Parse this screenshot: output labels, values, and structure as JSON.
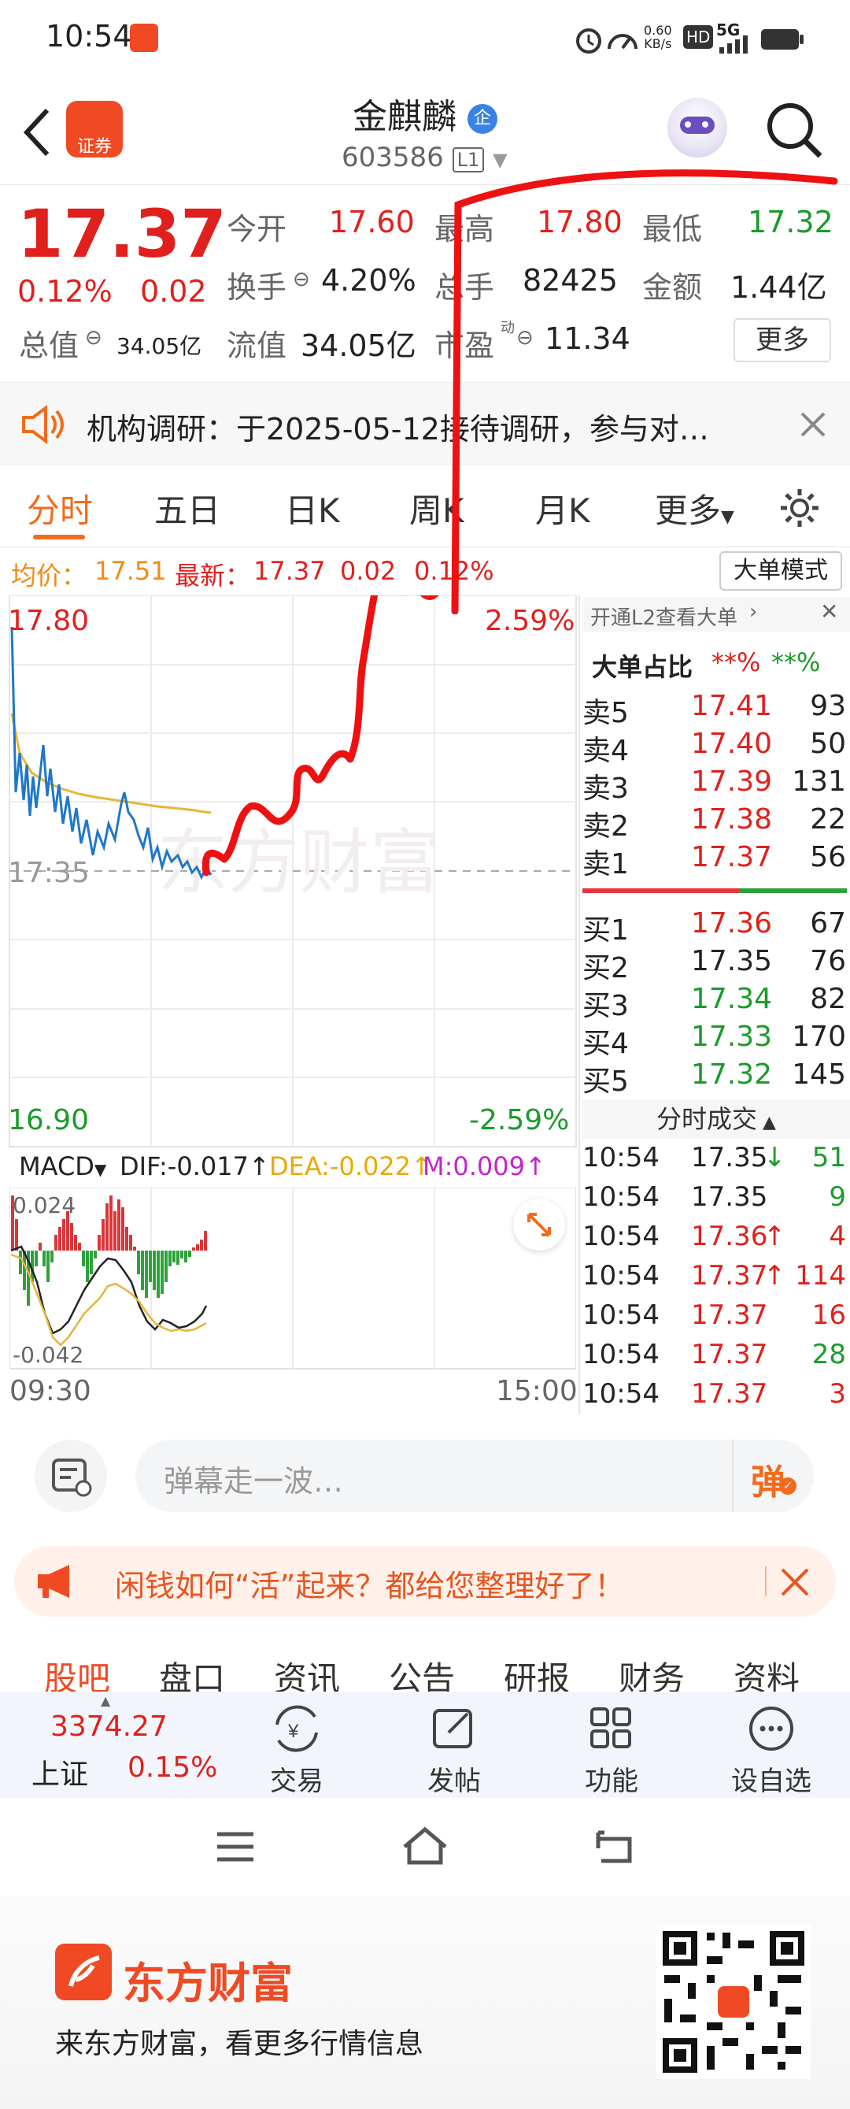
{
  "status_bar": {
    "time": "10:54",
    "net_speed": "0.60",
    "net_unit": "KB/s",
    "hd": "HD",
    "signal": "5G"
  },
  "header": {
    "logo_text": "证券",
    "stock_name": "金麒麟",
    "name_badge": "企",
    "stock_code": "603586",
    "level_badge": "L1"
  },
  "quote": {
    "price": "17.37",
    "change_pct": "0.12%",
    "change": "0.02",
    "row1": [
      {
        "label": "今开",
        "value": "17.60"
      },
      {
        "label": "最高",
        "value": "17.80"
      },
      {
        "label": "最低",
        "value": "17.32"
      }
    ],
    "row2": [
      {
        "label": "换手",
        "value": "4.20%"
      },
      {
        "label": "总手",
        "value": "82425"
      },
      {
        "label": "金额",
        "value": "1.44亿"
      }
    ],
    "row3": [
      {
        "label": "总值",
        "value": "34.05亿"
      },
      {
        "label": "流值",
        "value": "34.05亿"
      },
      {
        "label": "市盈",
        "sup": "动",
        "value": "11.34"
      }
    ],
    "more_label": "更多"
  },
  "notice": {
    "text": "机构调研：于2025-05-12接待调研，参与对…"
  },
  "chart_tabs": [
    "分时",
    "五日",
    "日K",
    "周K",
    "月K",
    "更多"
  ],
  "info_bar": {
    "avg_label": "均价：",
    "avg_value": "17.51",
    "latest_label": "最新：",
    "latest_value": "17.37",
    "change": "0.02",
    "change_pct": "0.12%",
    "mode_button": "大单模式"
  },
  "chart_labels": {
    "top_price": "17.80",
    "top_pct": "2.59%",
    "mid_price": "17:35",
    "bottom_price": "16.90",
    "bottom_pct": "-2.59%",
    "time_start": "09:30",
    "time_end": "15:00"
  },
  "macd": {
    "label": "MACD",
    "dif": "DIF:-0.017",
    "dea": "DEA:-0.022",
    "m": "M:0.009",
    "top_val": "0.024",
    "bottom_val": "-0.042"
  },
  "order_book": {
    "banner": "开通L2查看大单",
    "ratio_label": "大单占比",
    "ratio_red": "**%",
    "ratio_green": "**%",
    "sells": [
      {
        "label": "卖5",
        "price": "17.41",
        "vol": "93"
      },
      {
        "label": "卖4",
        "price": "17.40",
        "vol": "50"
      },
      {
        "label": "卖3",
        "price": "17.39",
        "vol": "131"
      },
      {
        "label": "卖2",
        "price": "17.38",
        "vol": "22"
      },
      {
        "label": "卖1",
        "price": "17.37",
        "vol": "56"
      }
    ],
    "buys": [
      {
        "label": "买1",
        "price": "17.36",
        "vol": "67"
      },
      {
        "label": "买2",
        "price": "17.35",
        "vol": "76"
      },
      {
        "label": "买3",
        "price": "17.34",
        "vol": "82"
      },
      {
        "label": "买4",
        "price": "17.33",
        "vol": "170"
      },
      {
        "label": "买5",
        "price": "17.32",
        "vol": "145"
      }
    ]
  },
  "trades": {
    "title": "分时成交",
    "rows": [
      {
        "time": "10:54",
        "price": "17.35",
        "arrow": "↓",
        "vol": "51"
      },
      {
        "time": "10:54",
        "price": "17.35",
        "arrow": "",
        "vol": "9"
      },
      {
        "time": "10:54",
        "price": "17.36",
        "arrow": "↑",
        "vol": "4"
      },
      {
        "time": "10:54",
        "price": "17.37",
        "arrow": "↑",
        "vol": "114"
      },
      {
        "time": "10:54",
        "price": "17.37",
        "arrow": "",
        "vol": "16"
      },
      {
        "time": "10:54",
        "price": "17.37",
        "arrow": "",
        "vol": "28"
      },
      {
        "time": "10:54",
        "price": "17.37",
        "arrow": "",
        "vol": "3"
      }
    ]
  },
  "danmu": {
    "placeholder": "弹幕走一波…",
    "button": "弹"
  },
  "ad": {
    "text": "闲钱如何“活”起来？都给您整理好了！"
  },
  "sub_tabs": [
    "股吧",
    "盘口",
    "资讯",
    "公告",
    "研报",
    "财务",
    "资料"
  ],
  "bottom_nav": {
    "index_value": "3374.27",
    "index_name": "上证",
    "index_pct": "0.15%",
    "items": [
      "交易",
      "发帖",
      "功能",
      "设自选"
    ]
  },
  "brand": {
    "name": "东方财富",
    "slogan": "来东方财富，看更多行情信息"
  },
  "colors": {
    "up": "#e0201c",
    "down": "#1a9b2a",
    "accent": "#f26b1d",
    "price_line": "#1f77c9",
    "avg_line": "#e7b53a"
  }
}
